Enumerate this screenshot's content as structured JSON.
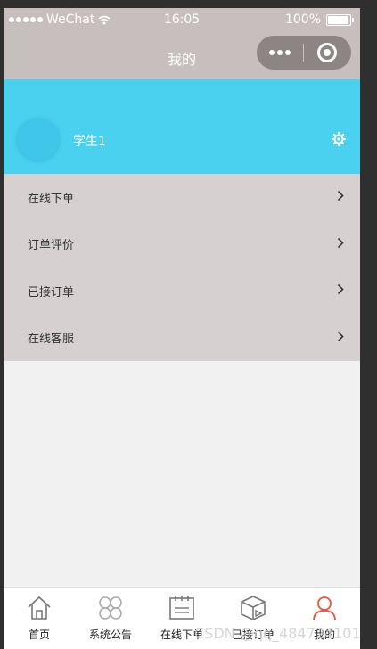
{
  "status_bar": {
    "carrier": "WeChat",
    "time": "16:05",
    "battery": "100%"
  },
  "nav": {
    "title": "我的"
  },
  "profile": {
    "username": "学生1"
  },
  "menu": {
    "items": [
      {
        "label": "在线下单"
      },
      {
        "label": "订单评价"
      },
      {
        "label": "已接订单"
      },
      {
        "label": "在线客服"
      }
    ]
  },
  "tabs": [
    {
      "label": "首页",
      "icon": "home-icon"
    },
    {
      "label": "系统公告",
      "icon": "clover-icon"
    },
    {
      "label": "在线下单",
      "icon": "calendar-icon"
    },
    {
      "label": "已接订单",
      "icon": "box-icon"
    },
    {
      "label": "我的",
      "icon": "user-icon",
      "active": true
    }
  ],
  "watermark": "CSDN @qq_484724101",
  "colors": {
    "header_bg": "#c6bfbe",
    "accent": "#4bd1f0",
    "menu_bg": "#d6d1d0",
    "active_tab": "#f0503c"
  }
}
